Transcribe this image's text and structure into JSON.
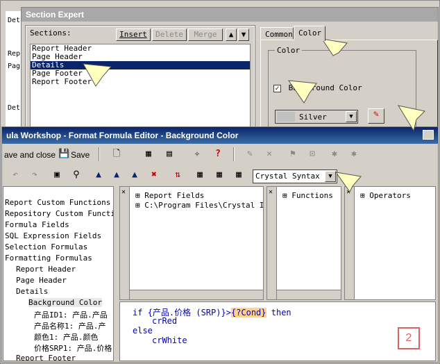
{
  "background_window": {
    "side_labels": [
      "Det",
      "Rep",
      "Pag",
      "Det"
    ]
  },
  "section_expert": {
    "title": "Section Expert",
    "sections_label": "Sections:",
    "buttons": {
      "insert": "Insert",
      "delete": "Delete",
      "merge": "Merge"
    },
    "sections": [
      "Report Header",
      "Page Header",
      "Details",
      "Page Footer",
      "Report Footer"
    ],
    "selected_section": "Details",
    "tabs": [
      "Common",
      "Color"
    ],
    "active_tab": "Color",
    "color_group_label": "Color",
    "background_color_label": "Background Color",
    "background_color_checked": true,
    "color_value": "Silver",
    "swatch_color": "#c0c0c0"
  },
  "formula_editor": {
    "title": "ula Workshop - Format Formula Editor - Background Color",
    "toolbar": {
      "save_and_close": "ave and close",
      "save": "Save"
    },
    "syntax_value": "Crystal Syntax",
    "workshop_tree": [
      "Report Custom Functions",
      "Repository Custom Functio",
      "Formula Fields",
      "SQL Expression Fields",
      "Selection Formulas",
      "Formatting Formulas",
      "Report Header",
      "Page Header",
      "Details",
      "Background Color",
      "产品ID1: 产品.产品",
      "产品名称1: 产品.产",
      "颜色1: 产品.颜色",
      "价格SRP1: 产品.价格",
      "Report Footer"
    ],
    "fields_pane": [
      "Report Fields",
      "C:\\Program Files\\Crystal I"
    ],
    "functions_pane": [
      "Functions"
    ],
    "operators_pane": [
      "Operators"
    ],
    "code": {
      "line1_kw": "if",
      "line1_expr": "{产品.价格 (SRP)}>",
      "line1_cond": "{?Cond}",
      "line1_then": "then",
      "line2": "crRed",
      "line3": "else",
      "line4": "crWhite"
    },
    "step_number": "2"
  },
  "colors": {
    "callout": "#ffffc0",
    "title_active": "#0a246a",
    "selection": "#0a246a",
    "step_badge": "#e06060",
    "cond_highlight": "#ffd090"
  }
}
